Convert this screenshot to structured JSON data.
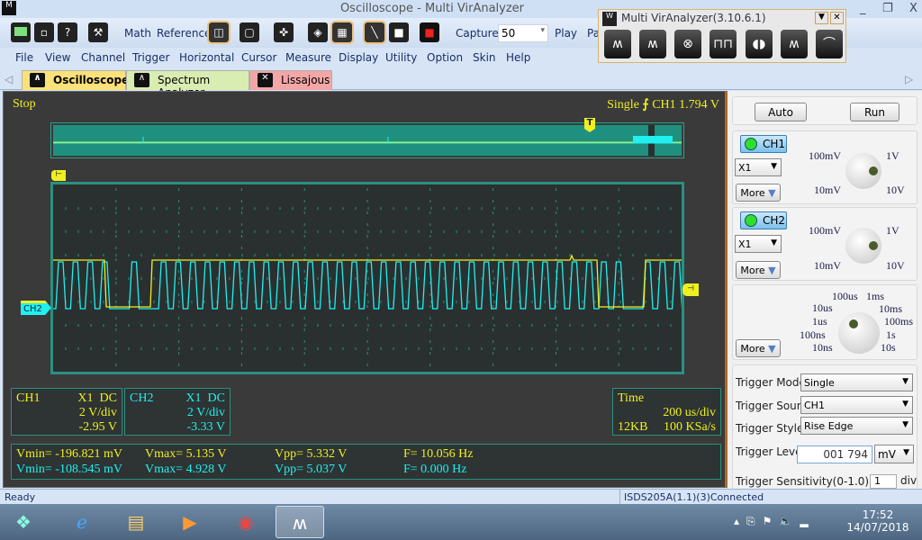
{
  "window": {
    "title": "Oscilloscope - Multi VirAnalyzer",
    "minimize": "_",
    "maximize": "❐",
    "close": "X"
  },
  "toolbar": {
    "math": "Math",
    "reference": "Reference",
    "capture_label": "Capture",
    "capture_value": "50",
    "play": "Play",
    "pause_partial": "Pa",
    "icons": [
      "open-icon",
      "save-icon",
      "help-icon",
      "hammer-icon",
      "split-view-icon",
      "single-view-icon",
      "crosshair-icon",
      "fft-icon",
      "persist-icon",
      "line-draw-icon",
      "stop-icon",
      "color-icon"
    ]
  },
  "menu": [
    "File",
    "View",
    "Channel",
    "Trigger",
    "Horizontal",
    "Cursor",
    "Measure",
    "Display",
    "Utility",
    "Option",
    "Skin",
    "Help"
  ],
  "tabs": [
    {
      "label": "Oscilloscope",
      "color": "#fbe17a",
      "active": true
    },
    {
      "label": "Spectrum Analyzer",
      "color": "#d9ecb2"
    },
    {
      "label": "Lissajous",
      "color": "#f2a6a6"
    }
  ],
  "palette": {
    "title": "Multi VirAnalyzer(3.10.6.1)",
    "tools": [
      "oscilloscope-icon",
      "spectrum-icon",
      "recorder-icon",
      "signal-generator-icon",
      "logic-icon",
      "analyzer-icon",
      "filter-icon"
    ]
  },
  "scope": {
    "status": "Stop",
    "trigger_info": {
      "mode": "Single",
      "source": "CH1",
      "level": "1.794 V"
    },
    "trigger_marker": "T",
    "ch2_marker": "CH2",
    "ch1": {
      "name": "CH1",
      "probe": "X1",
      "coupling": "DC",
      "scale": "2 V/div",
      "offset": "-2.95 V"
    },
    "ch2": {
      "name": "CH2",
      "probe": "X1",
      "coupling": "DC",
      "scale": "2 V/div",
      "offset": "-3.33 V"
    },
    "time": {
      "label": "Time",
      "scale": "200 us/div",
      "memory": "12KB",
      "rate": "100 KSa/s"
    },
    "measure": [
      {
        "vmin": "Vmin= -196.821 mV",
        "vmax": "Vmax= 5.135 V",
        "vpp": "Vpp= 5.332 V",
        "freq": "F= 10.056 Hz"
      },
      {
        "vmin": "Vmin= -108.545 mV",
        "vmax": "Vmax= 4.928 V",
        "vpp": "Vpp= 5.037 V",
        "freq": "F= 0.000 Hz"
      }
    ],
    "colors": {
      "ch1": "#f0f020",
      "ch2": "#20f0f0",
      "grid": "#2a9080"
    }
  },
  "panel": {
    "auto": "Auto",
    "run": "Run",
    "ch1": {
      "label": "CH1",
      "probe": "X1",
      "more": "More",
      "knob": [
        "100mV",
        "1V",
        "10mV",
        "10V"
      ]
    },
    "ch2": {
      "label": "CH2",
      "probe": "X1",
      "more": "More",
      "knob": [
        "100mV",
        "1V",
        "10mV",
        "10V"
      ]
    },
    "timebase": {
      "more": "More",
      "knob": [
        "100us",
        "1ms",
        "10us",
        "10ms",
        "1us",
        "100ms",
        "100ns",
        "1s",
        "10ns",
        "10s"
      ]
    },
    "trigger_mode": {
      "label": "Trigger Mode",
      "value": "Single"
    },
    "trigger_source": {
      "label": "Trigger Source",
      "value": "CH1"
    },
    "trigger_style": {
      "label": "Trigger Style",
      "value": "Rise Edge"
    },
    "trigger_level": {
      "label": "Trigger Level",
      "value": "001 794",
      "unit": "mV"
    },
    "trigger_sensitivity": {
      "label": "Trigger Sensitivity(0-1.0)",
      "value": "1",
      "unit": "div"
    }
  },
  "status": {
    "left": "Ready",
    "right": "ISDS205A(1.1)(3)Connected"
  },
  "taskbar": {
    "time": "17:52",
    "date": "14/07/2018",
    "apps": [
      "start-orb",
      "internet-explorer",
      "file-explorer",
      "media-player",
      "chrome",
      "multi-viranalyzer"
    ]
  }
}
